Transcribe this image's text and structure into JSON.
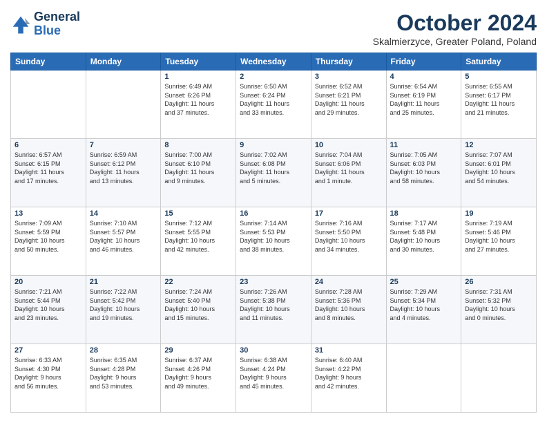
{
  "header": {
    "logo_line1": "General",
    "logo_line2": "Blue",
    "month_title": "October 2024",
    "subtitle": "Skalmierzyce, Greater Poland, Poland"
  },
  "days_of_week": [
    "Sunday",
    "Monday",
    "Tuesday",
    "Wednesday",
    "Thursday",
    "Friday",
    "Saturday"
  ],
  "weeks": [
    [
      {
        "day": "",
        "info": ""
      },
      {
        "day": "",
        "info": ""
      },
      {
        "day": "1",
        "info": "Sunrise: 6:49 AM\nSunset: 6:26 PM\nDaylight: 11 hours\nand 37 minutes."
      },
      {
        "day": "2",
        "info": "Sunrise: 6:50 AM\nSunset: 6:24 PM\nDaylight: 11 hours\nand 33 minutes."
      },
      {
        "day": "3",
        "info": "Sunrise: 6:52 AM\nSunset: 6:21 PM\nDaylight: 11 hours\nand 29 minutes."
      },
      {
        "day": "4",
        "info": "Sunrise: 6:54 AM\nSunset: 6:19 PM\nDaylight: 11 hours\nand 25 minutes."
      },
      {
        "day": "5",
        "info": "Sunrise: 6:55 AM\nSunset: 6:17 PM\nDaylight: 11 hours\nand 21 minutes."
      }
    ],
    [
      {
        "day": "6",
        "info": "Sunrise: 6:57 AM\nSunset: 6:15 PM\nDaylight: 11 hours\nand 17 minutes."
      },
      {
        "day": "7",
        "info": "Sunrise: 6:59 AM\nSunset: 6:12 PM\nDaylight: 11 hours\nand 13 minutes."
      },
      {
        "day": "8",
        "info": "Sunrise: 7:00 AM\nSunset: 6:10 PM\nDaylight: 11 hours\nand 9 minutes."
      },
      {
        "day": "9",
        "info": "Sunrise: 7:02 AM\nSunset: 6:08 PM\nDaylight: 11 hours\nand 5 minutes."
      },
      {
        "day": "10",
        "info": "Sunrise: 7:04 AM\nSunset: 6:06 PM\nDaylight: 11 hours\nand 1 minute."
      },
      {
        "day": "11",
        "info": "Sunrise: 7:05 AM\nSunset: 6:03 PM\nDaylight: 10 hours\nand 58 minutes."
      },
      {
        "day": "12",
        "info": "Sunrise: 7:07 AM\nSunset: 6:01 PM\nDaylight: 10 hours\nand 54 minutes."
      }
    ],
    [
      {
        "day": "13",
        "info": "Sunrise: 7:09 AM\nSunset: 5:59 PM\nDaylight: 10 hours\nand 50 minutes."
      },
      {
        "day": "14",
        "info": "Sunrise: 7:10 AM\nSunset: 5:57 PM\nDaylight: 10 hours\nand 46 minutes."
      },
      {
        "day": "15",
        "info": "Sunrise: 7:12 AM\nSunset: 5:55 PM\nDaylight: 10 hours\nand 42 minutes."
      },
      {
        "day": "16",
        "info": "Sunrise: 7:14 AM\nSunset: 5:53 PM\nDaylight: 10 hours\nand 38 minutes."
      },
      {
        "day": "17",
        "info": "Sunrise: 7:16 AM\nSunset: 5:50 PM\nDaylight: 10 hours\nand 34 minutes."
      },
      {
        "day": "18",
        "info": "Sunrise: 7:17 AM\nSunset: 5:48 PM\nDaylight: 10 hours\nand 30 minutes."
      },
      {
        "day": "19",
        "info": "Sunrise: 7:19 AM\nSunset: 5:46 PM\nDaylight: 10 hours\nand 27 minutes."
      }
    ],
    [
      {
        "day": "20",
        "info": "Sunrise: 7:21 AM\nSunset: 5:44 PM\nDaylight: 10 hours\nand 23 minutes."
      },
      {
        "day": "21",
        "info": "Sunrise: 7:22 AM\nSunset: 5:42 PM\nDaylight: 10 hours\nand 19 minutes."
      },
      {
        "day": "22",
        "info": "Sunrise: 7:24 AM\nSunset: 5:40 PM\nDaylight: 10 hours\nand 15 minutes."
      },
      {
        "day": "23",
        "info": "Sunrise: 7:26 AM\nSunset: 5:38 PM\nDaylight: 10 hours\nand 11 minutes."
      },
      {
        "day": "24",
        "info": "Sunrise: 7:28 AM\nSunset: 5:36 PM\nDaylight: 10 hours\nand 8 minutes."
      },
      {
        "day": "25",
        "info": "Sunrise: 7:29 AM\nSunset: 5:34 PM\nDaylight: 10 hours\nand 4 minutes."
      },
      {
        "day": "26",
        "info": "Sunrise: 7:31 AM\nSunset: 5:32 PM\nDaylight: 10 hours\nand 0 minutes."
      }
    ],
    [
      {
        "day": "27",
        "info": "Sunrise: 6:33 AM\nSunset: 4:30 PM\nDaylight: 9 hours\nand 56 minutes."
      },
      {
        "day": "28",
        "info": "Sunrise: 6:35 AM\nSunset: 4:28 PM\nDaylight: 9 hours\nand 53 minutes."
      },
      {
        "day": "29",
        "info": "Sunrise: 6:37 AM\nSunset: 4:26 PM\nDaylight: 9 hours\nand 49 minutes."
      },
      {
        "day": "30",
        "info": "Sunrise: 6:38 AM\nSunset: 4:24 PM\nDaylight: 9 hours\nand 45 minutes."
      },
      {
        "day": "31",
        "info": "Sunrise: 6:40 AM\nSunset: 4:22 PM\nDaylight: 9 hours\nand 42 minutes."
      },
      {
        "day": "",
        "info": ""
      },
      {
        "day": "",
        "info": ""
      }
    ]
  ]
}
